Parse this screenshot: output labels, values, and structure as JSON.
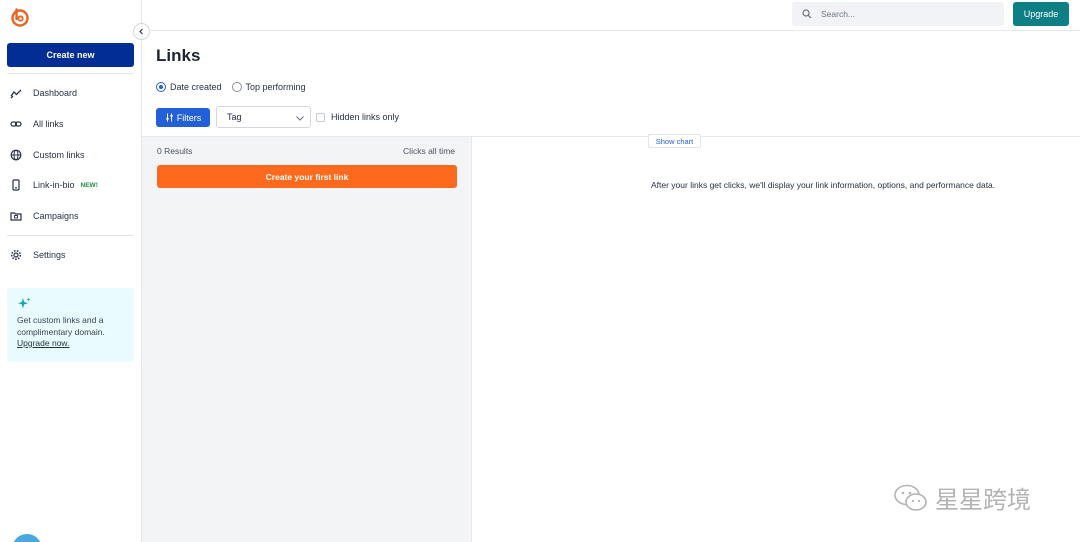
{
  "sidebar": {
    "create_label": "Create new",
    "items": [
      {
        "label": "Dashboard",
        "icon": "chart-line-icon"
      },
      {
        "label": "All links",
        "icon": "link-icon"
      },
      {
        "label": "Custom links",
        "icon": "globe-icon"
      },
      {
        "label": "Link-in-bio",
        "icon": "phone-icon",
        "badge": "NEW!"
      },
      {
        "label": "Campaigns",
        "icon": "folder-icon"
      },
      {
        "label": "Settings",
        "icon": "gear-icon"
      }
    ],
    "promo": {
      "text": "Get custom links and a complimentary domain.",
      "link": "Upgrade now."
    }
  },
  "topbar": {
    "search_placeholder": "Search...",
    "upgrade_label": "Upgrade"
  },
  "main": {
    "title": "Links",
    "sort_options": [
      {
        "label": "Date created",
        "selected": true
      },
      {
        "label": "Top performing",
        "selected": false
      }
    ],
    "filters_label": "Filters",
    "tag_placeholder": "Tag",
    "hidden_only_label": "Hidden links only",
    "results_label": "0 Results",
    "clicks_label": "Clicks all time",
    "create_first_label": "Create your first link",
    "show_chart_label": "Show chart",
    "empty_message": "After your links get clicks, we'll display your link information, options, and performance data."
  },
  "watermark": {
    "text": "星星跨境"
  },
  "colors": {
    "brand_blue": "#022d94",
    "accent_blue": "#2360d8",
    "orange": "#fd6a1e",
    "teal": "#0f7f86"
  }
}
